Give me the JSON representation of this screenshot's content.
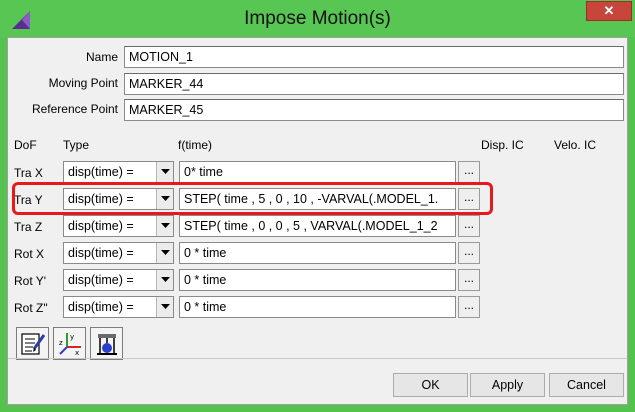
{
  "window": {
    "title": "Impose Motion(s)",
    "close_label": "✕"
  },
  "header_fields": [
    {
      "label": "Name",
      "value": "MOTION_1"
    },
    {
      "label": "Moving Point",
      "value": "MARKER_44"
    },
    {
      "label": "Reference Point",
      "value": "MARKER_45"
    }
  ],
  "columns": {
    "dof": "DoF",
    "type": "Type",
    "ftime": "f(time)",
    "disp_ic": "Disp. IC",
    "velo_ic": "Velo. IC"
  },
  "rows": [
    {
      "dof": "Tra X",
      "type": "disp(time) =",
      "expr": "0* time",
      "dots": "..."
    },
    {
      "dof": "Tra Y",
      "type": "disp(time) =",
      "expr": "STEP( time , 5 , 0 , 10 , -VARVAL(.MODEL_1.",
      "dots": "..."
    },
    {
      "dof": "Tra Z",
      "type": "disp(time) =",
      "expr": "STEP( time , 0 , 0 , 5 , VARVAL(.MODEL_1_2",
      "dots": "..."
    },
    {
      "dof": "Rot X",
      "type": "disp(time) =",
      "expr": "0 * time",
      "dots": "..."
    },
    {
      "dof": "Rot Y'",
      "type": "disp(time) =",
      "expr": "0 * time",
      "dots": "..."
    },
    {
      "dof": "Rot Z\"",
      "type": "disp(time) =",
      "expr": "0 * time",
      "dots": "..."
    }
  ],
  "tools": [
    {
      "icon": "edit-list-icon"
    },
    {
      "icon": "coordinate-axes-icon"
    },
    {
      "icon": "joint-motion-icon"
    }
  ],
  "buttons": {
    "ok": "OK",
    "apply": "Apply",
    "cancel": "Cancel"
  },
  "colors": {
    "titlebar": "#58c652",
    "highlight": "#e8191b",
    "close": "#c7453b"
  }
}
